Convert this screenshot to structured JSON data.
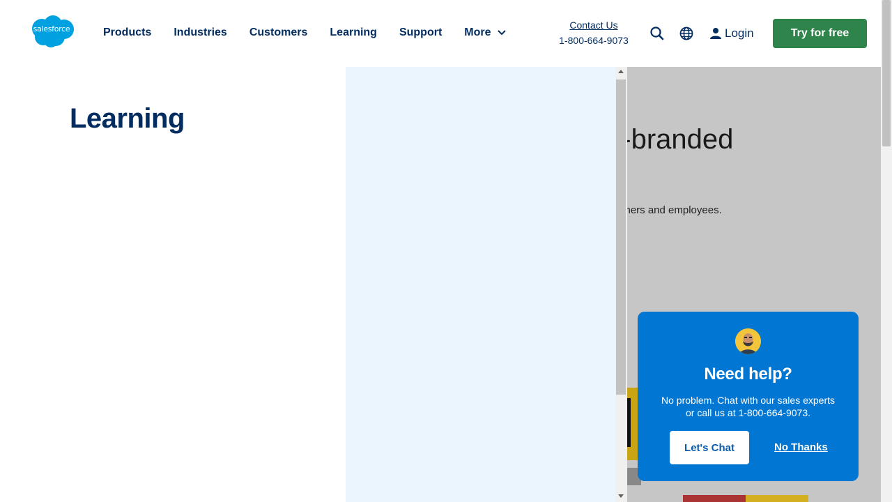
{
  "header": {
    "logo_text": "salesforce",
    "nav": [
      {
        "label": "Products"
      },
      {
        "label": "Industries"
      },
      {
        "label": "Customers"
      },
      {
        "label": "Learning"
      },
      {
        "label": "Support"
      },
      {
        "label": "More"
      }
    ],
    "contact_link": "Contact Us",
    "contact_phone": "1-800-664-9073",
    "login_label": "Login",
    "try_label": "Try for free"
  },
  "learning_menu": {
    "title": "Learning"
  },
  "hero": {
    "title_fragment": "n-branded",
    "subtitle_fragment": "omers and employees."
  },
  "chat": {
    "title": "Need help?",
    "body": "No problem. Chat with our sales experts or call us at 1-800-664-9073.",
    "primary_label": "Let's Chat",
    "secondary_label": "No Thanks"
  },
  "colors": {
    "brand_blue": "#0176d3",
    "nav_text": "#032d60",
    "cta_green": "#2e844a",
    "pane_bg": "#eaf5fe",
    "overlay_bg": "#c6c6c6"
  }
}
